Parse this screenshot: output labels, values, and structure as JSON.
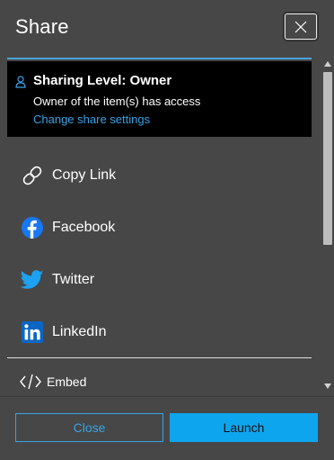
{
  "dialog": {
    "title": "Share",
    "close_icon": "close-icon"
  },
  "sharing": {
    "level_label": "Sharing Level: Owner",
    "description": "Owner of the item(s) has access",
    "change_link": "Change share settings",
    "icon": "user-icon"
  },
  "share_options": [
    {
      "label": "Copy Link",
      "icon": "link-icon"
    },
    {
      "label": "Facebook",
      "icon": "facebook-icon",
      "color": "#1877f2"
    },
    {
      "label": "Twitter",
      "icon": "twitter-icon",
      "color": "#1da1f2"
    },
    {
      "label": "LinkedIn",
      "icon": "linkedin-icon",
      "color": "#0a66c2"
    }
  ],
  "embed": {
    "label": "Embed",
    "icon": "code-icon"
  },
  "footer": {
    "close_label": "Close",
    "launch_label": "Launch"
  },
  "colors": {
    "accent": "#0ea5ef",
    "link": "#37a3e6",
    "background": "#474747"
  }
}
